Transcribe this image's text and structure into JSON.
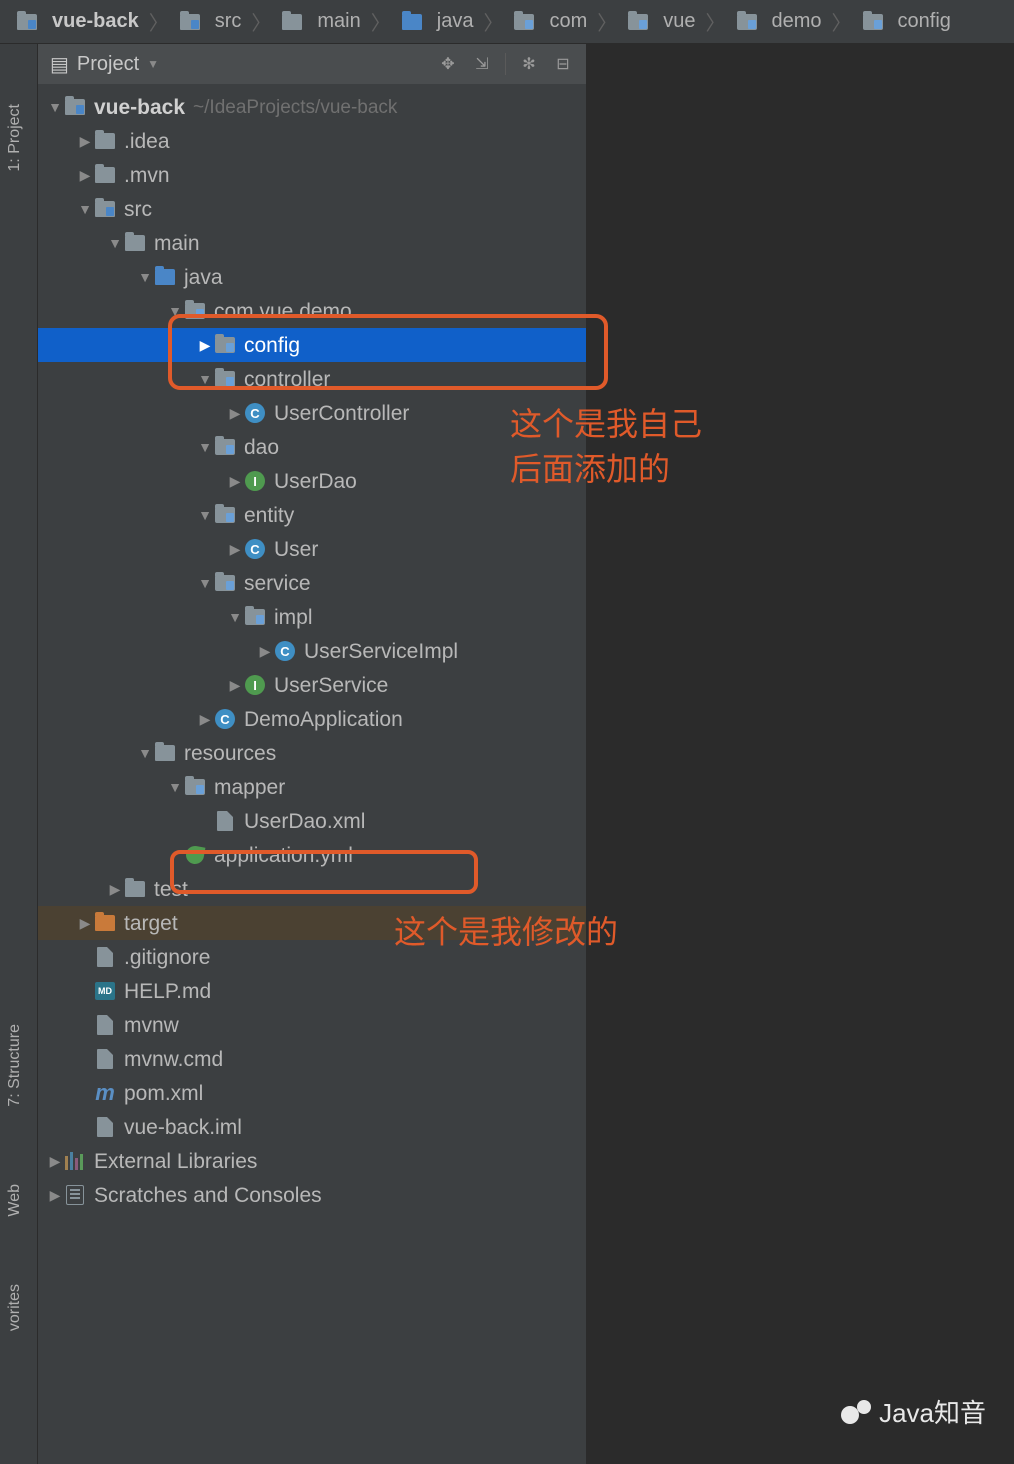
{
  "breadcrumb": [
    {
      "label": "vue-back",
      "icon": "folder-blue-tab",
      "bold": true
    },
    {
      "label": "src",
      "icon": "folder-blue-tab"
    },
    {
      "label": "main",
      "icon": "folder"
    },
    {
      "label": "java",
      "icon": "folder-blue"
    },
    {
      "label": "com",
      "icon": "pkg"
    },
    {
      "label": "vue",
      "icon": "pkg"
    },
    {
      "label": "demo",
      "icon": "pkg"
    },
    {
      "label": "config",
      "icon": "pkg"
    }
  ],
  "panel": {
    "title": "Project"
  },
  "side_tabs": {
    "project": "1: Project",
    "structure": "7: Structure",
    "web": "Web",
    "favorites": "vorites"
  },
  "root": {
    "name": "vue-back",
    "hint": "~/IdeaProjects/vue-back"
  },
  "tree": {
    "idea": ".idea",
    "mvn": ".mvn",
    "src": "src",
    "main": "main",
    "java": "java",
    "pkg_root": "com.vue.demo",
    "config": "config",
    "controller": "controller",
    "userController": "UserController",
    "dao": "dao",
    "userDao": "UserDao",
    "entity": "entity",
    "user": "User",
    "service": "service",
    "impl": "impl",
    "userServiceImpl": "UserServiceImpl",
    "userService": "UserService",
    "demoApp": "DemoApplication",
    "resources": "resources",
    "mapper": "mapper",
    "userDaoXml": "UserDao.xml",
    "appYml": "application.yml",
    "test": "test",
    "target": "target",
    "gitignore": ".gitignore",
    "help": "HELP.md",
    "mvnw": "mvnw",
    "mvnwCmd": "mvnw.cmd",
    "pom": "pom.xml",
    "iml": "vue-back.iml",
    "extLib": "External Libraries",
    "scratches": "Scratches and Consoles"
  },
  "annotations": {
    "text1_l1": "这个是我自己",
    "text1_l2": "后面添加的",
    "text2": "这个是我修改的"
  },
  "watermark": "Java知音"
}
